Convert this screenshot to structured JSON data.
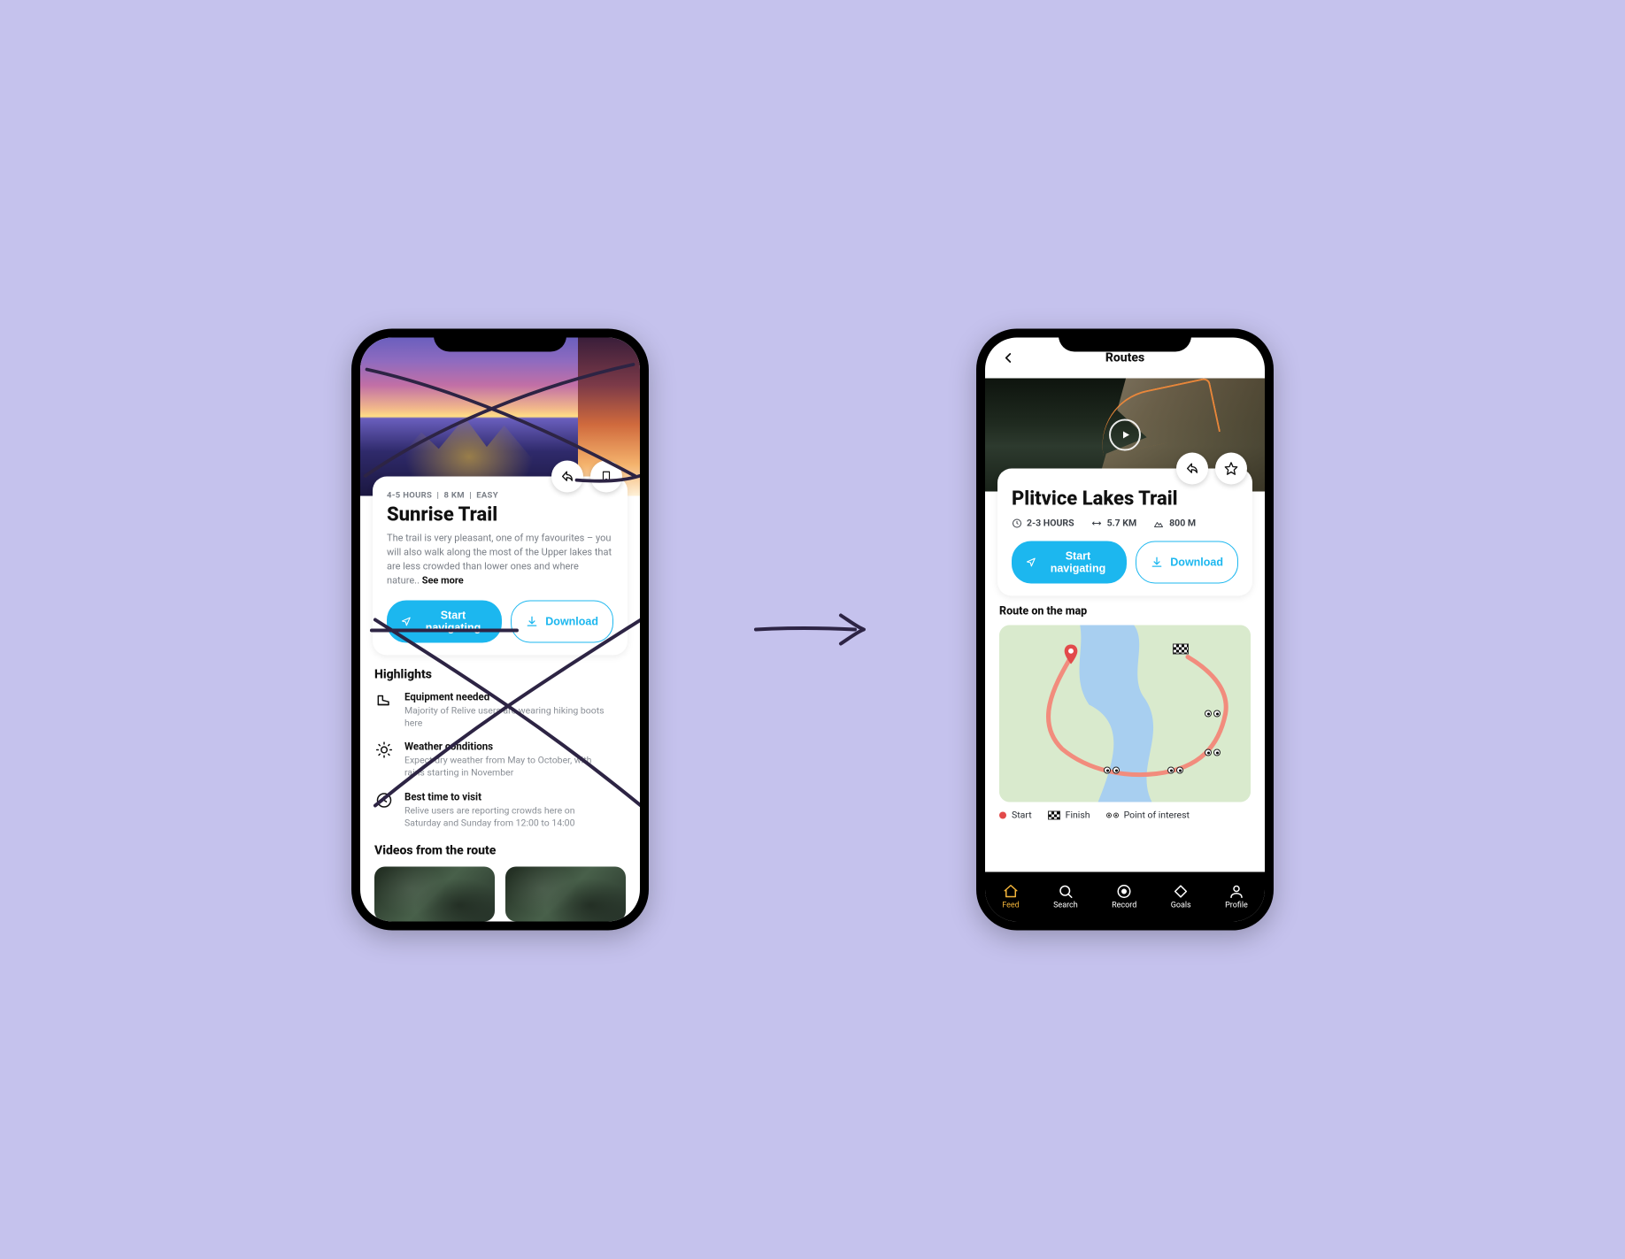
{
  "colors": {
    "accent": "#1cb7ef",
    "tabActive": "#f2b43a",
    "scribble": "#2d2444"
  },
  "phoneA": {
    "meta": {
      "duration": "4-5 HOURS",
      "distance": "8 KM",
      "difficulty": "EASY"
    },
    "title": "Sunrise Trail",
    "description": "The trail is very pleasant, one of my favourites – you will also walk along the most of the Upper lakes that are less crowded than lower ones and where nature..",
    "see_more": "See more",
    "buttons": {
      "start": "Start navigating",
      "download": "Download"
    },
    "highlights_heading": "Highlights",
    "highlights": [
      {
        "icon": "boot-icon",
        "title": "Equipment needed",
        "sub": "Majority of Relive users are wearing hiking boots here"
      },
      {
        "icon": "sun-icon",
        "title": "Weather conditions",
        "sub": "Expect dry weather from May to October, with rains starting in November"
      },
      {
        "icon": "clock-icon",
        "title": "Best time to visit",
        "sub": "Relive users are reporting crowds here on Saturday and Sunday from 12:00 to 14:00"
      }
    ],
    "videos_heading": "Videos from the route"
  },
  "phoneB": {
    "topbar": {
      "title": "Routes"
    },
    "title": "Plitvice Lakes Trail",
    "stats": {
      "duration": "2-3 HOURS",
      "distance": "5.7 KM",
      "elevation": "800 M"
    },
    "buttons": {
      "start": "Start navigating",
      "download": "Download"
    },
    "map_heading": "Route on the map",
    "legend": {
      "start": "Start",
      "finish": "Finish",
      "poi": "Point of interest"
    },
    "tabs": [
      {
        "id": "feed",
        "label": "Feed",
        "active": true
      },
      {
        "id": "search",
        "label": "Search",
        "active": false
      },
      {
        "id": "record",
        "label": "Record",
        "active": false
      },
      {
        "id": "goals",
        "label": "Goals",
        "active": false
      },
      {
        "id": "profile",
        "label": "Profile",
        "active": false
      }
    ]
  }
}
